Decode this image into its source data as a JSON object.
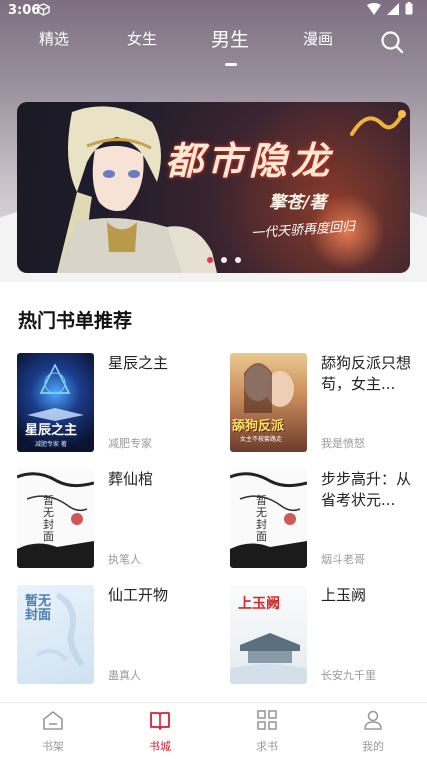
{
  "status_bar": {
    "time": "3:06"
  },
  "nav": {
    "tabs": [
      {
        "label": "精选"
      },
      {
        "label": "女生"
      },
      {
        "label": "男生"
      },
      {
        "label": "漫画"
      }
    ],
    "active_tab": "男生"
  },
  "banner": {
    "title": "都市隐龙",
    "author": "擎苍/著",
    "tagline": "一代天骄再度回归",
    "slide_count": 3,
    "active_slide": 1
  },
  "section": {
    "title": "热门书单推荐",
    "books": [
      {
        "name": "星辰之主",
        "author": "减肥专家",
        "cover": "cover-star",
        "cover_text": "星辰之主",
        "cover_subtext": "减肥专家 著"
      },
      {
        "name": "舔狗反派只想苟，女主...",
        "author": "我是愤怒",
        "cover": "cover-dog",
        "cover_text": "舔狗反派",
        "cover_subtext": "女主不按套路走"
      },
      {
        "name": "葬仙棺",
        "author": "执笔人",
        "cover": "cover-ink",
        "cover_text": "暂无封面"
      },
      {
        "name": "步步高升：从省考状元...",
        "author": "烟斗老哥",
        "cover": "cover-ink",
        "cover_text": "暂无封面"
      },
      {
        "name": "仙工开物",
        "author": "蛊真人",
        "cover": "cover-blank",
        "cover_text": "暂无封面"
      },
      {
        "name": "上玉阙",
        "author": "长安九千里",
        "cover": "cover-jade",
        "cover_text": "上玉阙"
      }
    ]
  },
  "bottom_nav": {
    "items": [
      {
        "label": "书架",
        "icon": "bookshelf-icon"
      },
      {
        "label": "书城",
        "icon": "book-open-icon"
      },
      {
        "label": "求书",
        "icon": "grid-icon"
      },
      {
        "label": "我的",
        "icon": "user-icon"
      }
    ],
    "active": "书城"
  },
  "colors": {
    "accent": "#d81e34",
    "inactive": "#999999"
  }
}
